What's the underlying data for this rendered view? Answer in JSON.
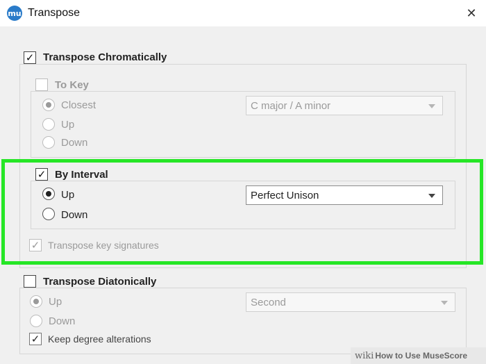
{
  "window": {
    "title": "Transpose",
    "app_icon_text": "mu"
  },
  "chromatic": {
    "label": "Transpose Chromatically",
    "checked": true,
    "to_key": {
      "label": "To Key",
      "checked": false,
      "options": [
        "Closest",
        "Up",
        "Down"
      ],
      "selected": "Closest",
      "key_value": "C major / A minor"
    },
    "by_interval": {
      "label": "By Interval",
      "checked": true,
      "options": [
        "Up",
        "Down"
      ],
      "selected": "Up",
      "interval_value": "Perfect Unison"
    },
    "key_signatures": {
      "label": "Transpose key signatures",
      "checked": true
    }
  },
  "diatonic": {
    "label": "Transpose Diatonically",
    "checked": false,
    "options": [
      "Up",
      "Down"
    ],
    "selected": "Up",
    "degree_value": "Second",
    "keep_alterations": {
      "label": "Keep degree alterations",
      "checked": true
    }
  },
  "highlight_color": "#26e626",
  "watermark": {
    "prefix": "wiki",
    "text": "How to Use MuseScore"
  }
}
